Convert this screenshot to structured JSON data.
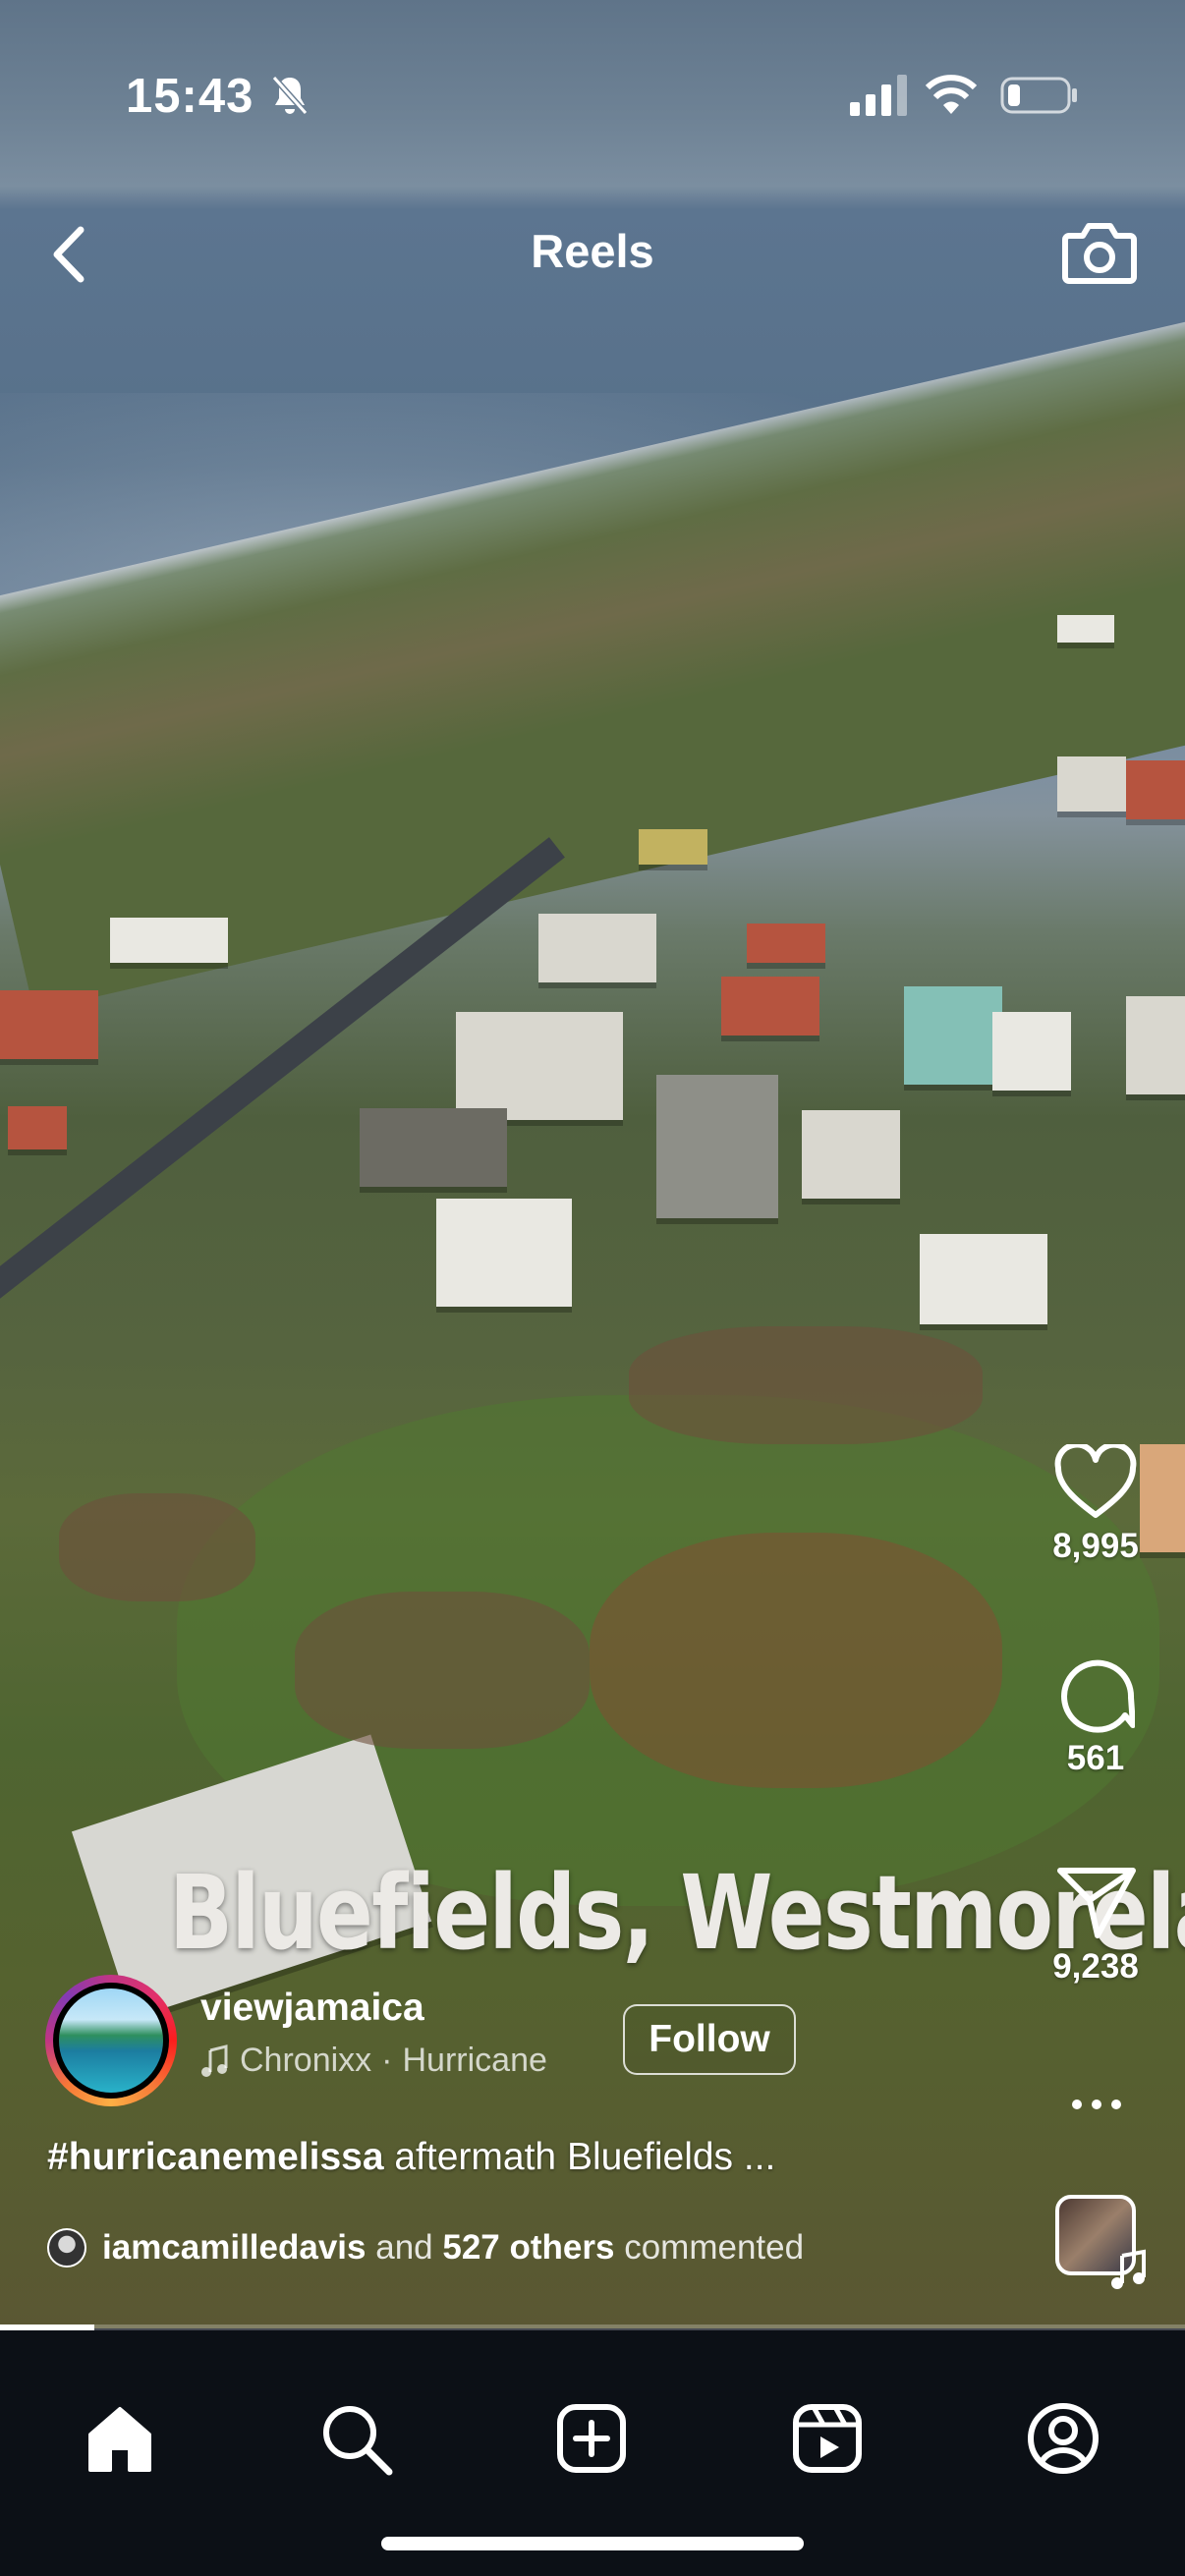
{
  "status_bar": {
    "time": "15:43",
    "battery_level_percent": 20
  },
  "header": {
    "title": "Reels"
  },
  "video": {
    "overlay_text": "Bluefields, Westmoreland",
    "progress_percent": 8
  },
  "actions": {
    "likes": "8,995",
    "comments": "561",
    "shares": "9,238"
  },
  "author": {
    "username": "viewjamaica",
    "music_artist": "Chronixx",
    "music_separator": "·",
    "music_title": "Hurricane",
    "follow_label": "Follow"
  },
  "caption": {
    "hashtag": "#hurricanemelissa",
    "text": " aftermath Bluefields ..."
  },
  "comments_preview": {
    "user": "iamcamilledavis",
    "and_text": "and",
    "others": "527 others",
    "suffix": "commented"
  },
  "tabs": [
    "home",
    "search",
    "create",
    "reels",
    "profile"
  ],
  "colors": {
    "tab_bar_bg": "#0c1016",
    "text": "#ffffff"
  }
}
